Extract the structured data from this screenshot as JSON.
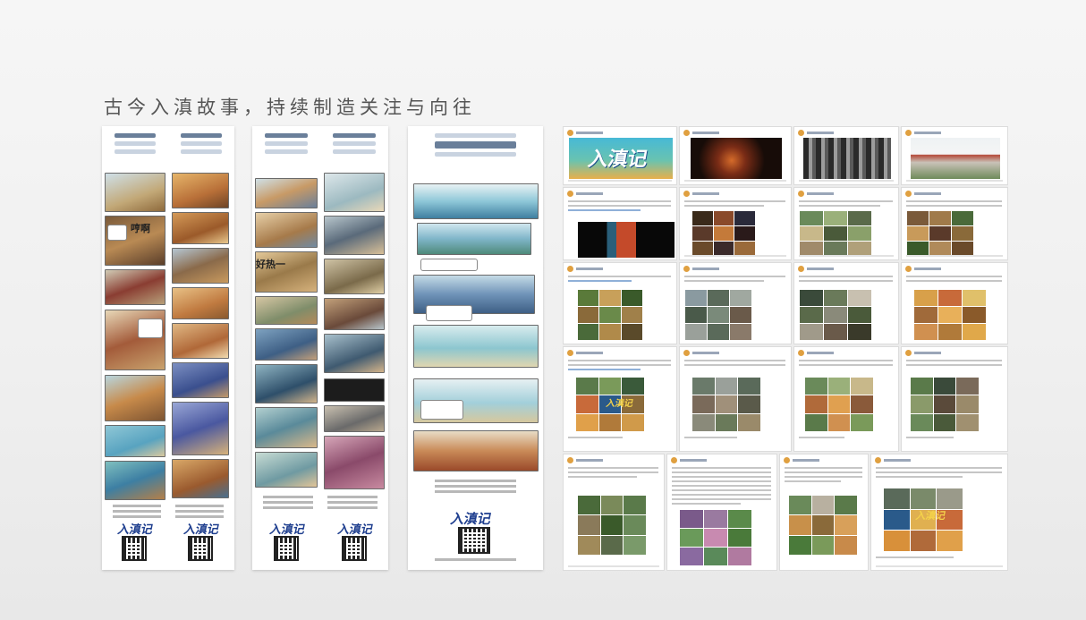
{
  "heading": "古今入滇故事，持续制造关注与向往",
  "comic_strips": {
    "strip1": {
      "shout_text": "哼啊",
      "logo": "入滇记"
    },
    "strip2": {
      "shout_text": "好热一",
      "logo": "入滇记"
    },
    "strip3": {
      "logo": "入滇记"
    }
  },
  "social_collage": {
    "banner_logo": "入滇记",
    "post_logo": "入滇记"
  },
  "colors": {
    "heading": "#555555",
    "brand_blue": "#1f3f8f",
    "banner_sky": "#47b9d6",
    "banner_warm": "#e8b04b"
  }
}
